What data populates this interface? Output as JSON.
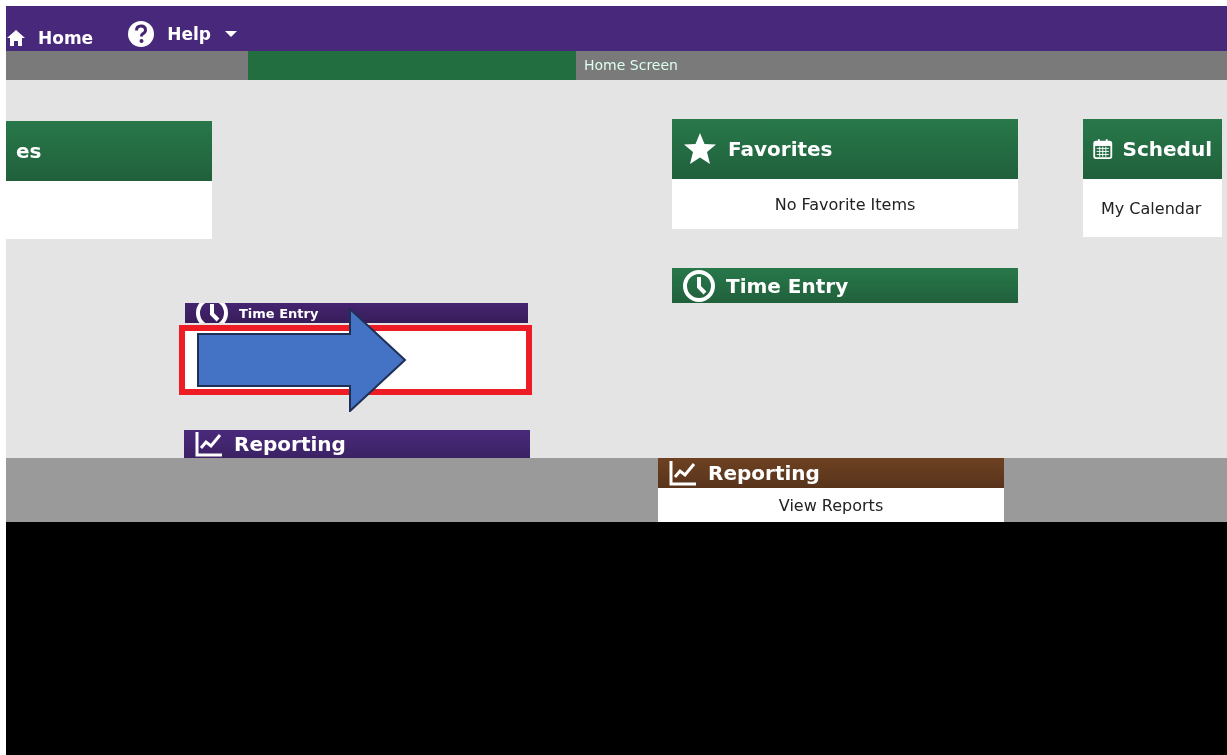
{
  "nav": {
    "items": [
      {
        "label": "Home",
        "kind": "home"
      },
      {
        "label": "Help",
        "kind": "help"
      }
    ]
  },
  "breadcrumb": {
    "title": "Home Screen"
  },
  "top_cards": [
    {
      "title": "es",
      "color": "#28784a"
    },
    {
      "title": "Favorites",
      "color": "#28784a",
      "items": [
        "No Favorite Items"
      ]
    },
    {
      "title": "Time Entry",
      "color": "#28784a"
    },
    {
      "title": "Schedul",
      "color": "#28784a",
      "items": [
        "My Calendar"
      ]
    }
  ],
  "highlight_panel": {
    "header": {
      "title": "Time Entry",
      "color": "#452470"
    },
    "next_header": {
      "title": "Reporting",
      "color": "#4a2a7c"
    }
  },
  "lower_card": {
    "title": "Reporting",
    "color": "#6e4122",
    "items": [
      "View Reports"
    ]
  }
}
